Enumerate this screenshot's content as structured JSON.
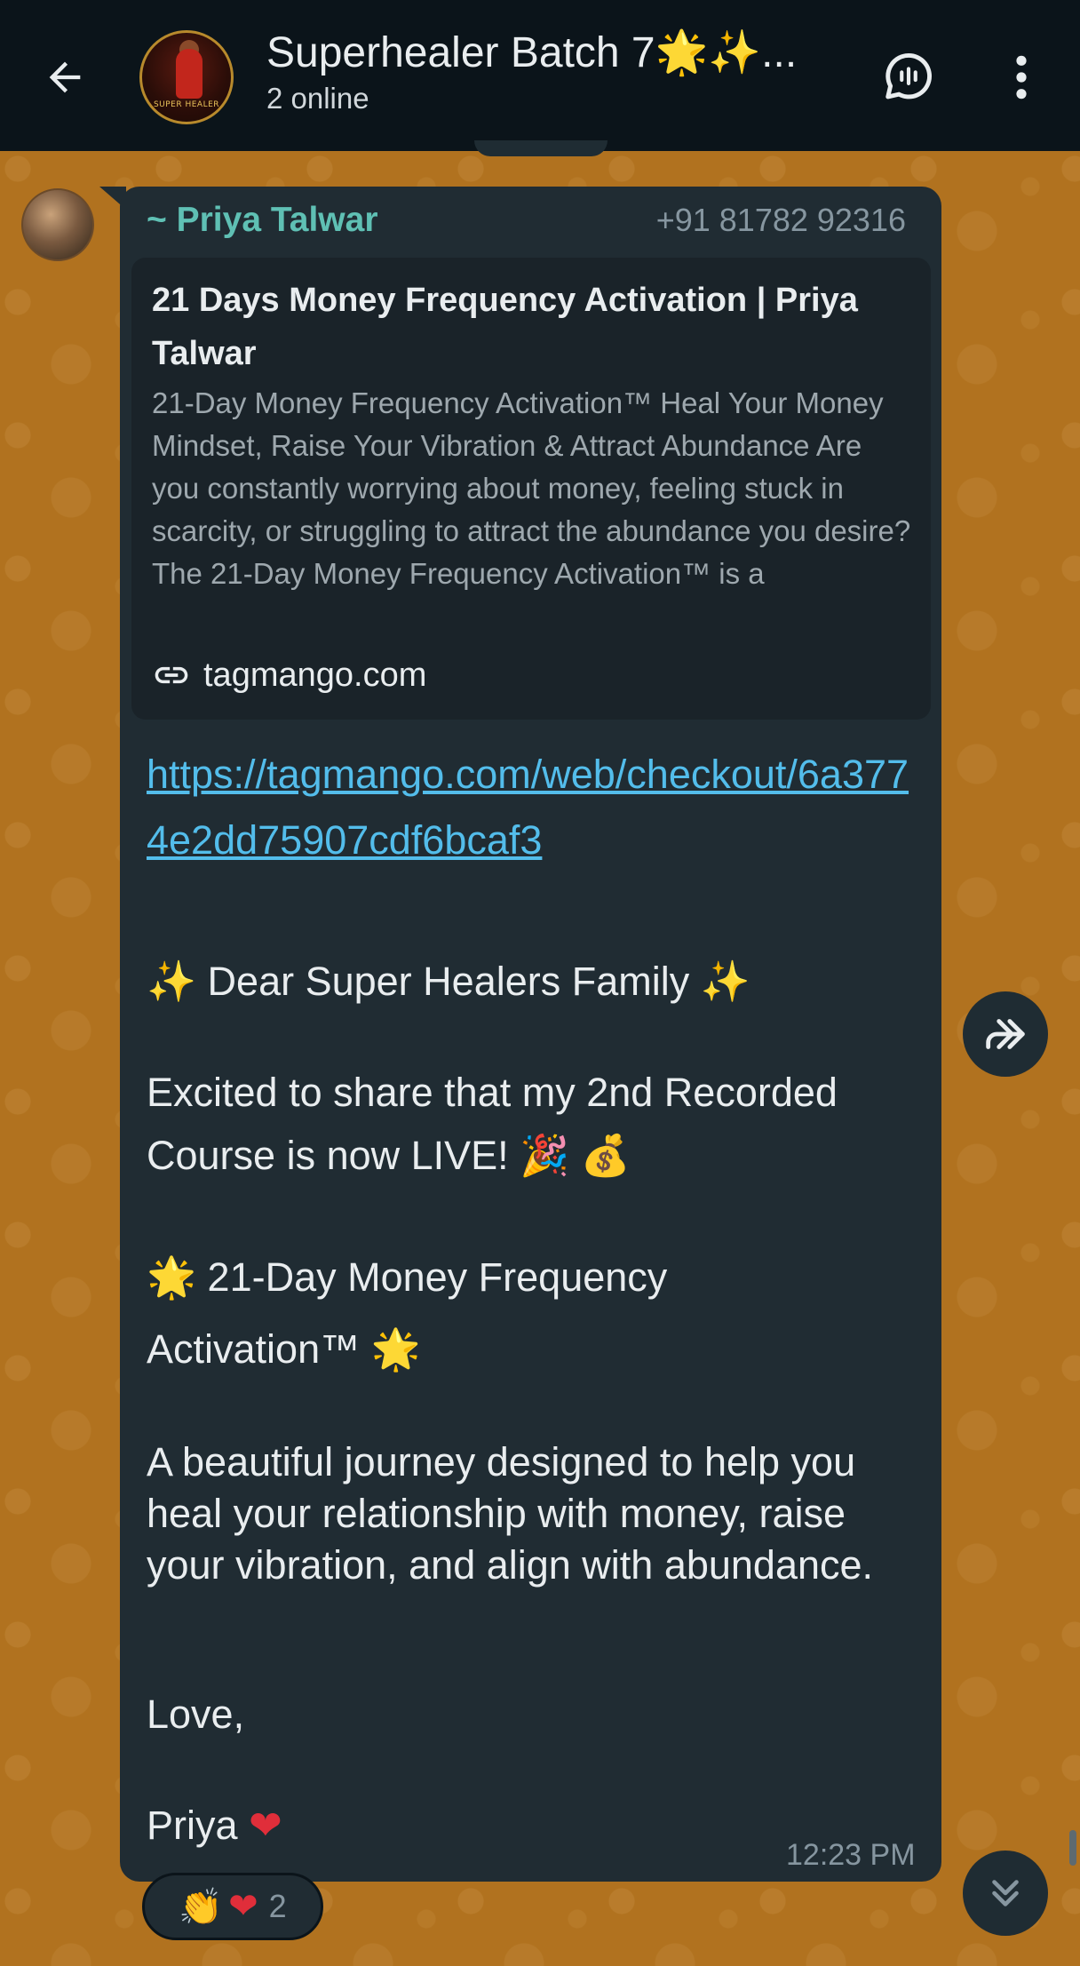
{
  "header": {
    "title": "Superhealer Batch 7🌟✨...",
    "subtitle": "2 online",
    "avatar_text": "SUPER HEALER"
  },
  "message": {
    "sender_name": "~ Priya Talwar",
    "sender_phone": "+91 81782 92316",
    "link_preview": {
      "title": "21 Days Money Frequency Activation | Priya Talwar",
      "description": "21-Day Money Frequency Activation™ Heal Your Money Mindset, Raise Your Vibration & Attract Abundance Are you constantly worrying about money, feeling stuck in scarcity, or struggling to attract the abundance you desire? The 21-Day Money Frequency Activation™ is a transformation…",
      "domain": "tagmango.com"
    },
    "link_url": "https://tagmango.com/web/checkout/6a3774e2dd75907cdf6bcaf3",
    "greeting": "Dear Super Healers Family",
    "announce_1": "Excited to share that my 2nd Recorded",
    "announce_2": "Course is now LIVE!",
    "course_1": "21-Day Money Frequency",
    "course_2": "Activation™",
    "body": "A beautiful journey designed to help you heal your relationship with money, raise your vibration, and align with abundance.",
    "signoff": "Love,",
    "signature": "Priya",
    "time": "12:23 PM",
    "reaction_count": "2"
  },
  "icons": {
    "back": "back-arrow-icon",
    "voice_chat": "voice-chat-icon",
    "menu": "more-vert-icon",
    "link": "link-icon",
    "forward": "forward-icon",
    "scroll_down": "double-chevron-down-icon"
  },
  "colors": {
    "header_bg": "#0b141a",
    "bubble_bg": "#202c33",
    "link": "#53bdeb",
    "sender_name": "#5fc0b4",
    "wallpaper": "#b1721f"
  }
}
